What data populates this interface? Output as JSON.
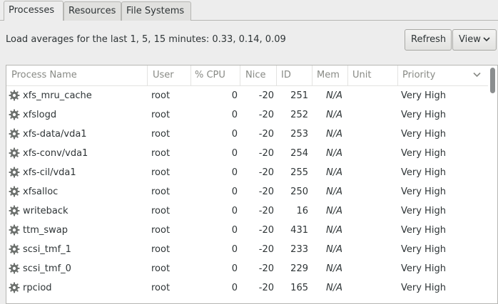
{
  "tabs": [
    {
      "label": "Processes",
      "active": true
    },
    {
      "label": "Resources",
      "active": false
    },
    {
      "label": "File Systems",
      "active": false
    }
  ],
  "load_text": "Load averages for the last 1, 5, 15 minutes: 0.33, 0.14, 0.09",
  "buttons": {
    "refresh": "Refresh",
    "view": "View"
  },
  "columns": {
    "name": "Process Name",
    "user": "User",
    "cpu": "% CPU",
    "nice": "Nice",
    "id": "ID",
    "mem": "Mem",
    "unit": "Unit",
    "priority": "Priority"
  },
  "sort_indicator": "chevron-down",
  "rows": [
    {
      "name": "xfs_mru_cache",
      "user": "root",
      "cpu": "0",
      "nice": "-20",
      "id": "251",
      "mem": "N/A",
      "unit": "",
      "priority": "Very High"
    },
    {
      "name": "xfslogd",
      "user": "root",
      "cpu": "0",
      "nice": "-20",
      "id": "252",
      "mem": "N/A",
      "unit": "",
      "priority": "Very High"
    },
    {
      "name": "xfs-data/vda1",
      "user": "root",
      "cpu": "0",
      "nice": "-20",
      "id": "253",
      "mem": "N/A",
      "unit": "",
      "priority": "Very High"
    },
    {
      "name": "xfs-conv/vda1",
      "user": "root",
      "cpu": "0",
      "nice": "-20",
      "id": "254",
      "mem": "N/A",
      "unit": "",
      "priority": "Very High"
    },
    {
      "name": "xfs-cil/vda1",
      "user": "root",
      "cpu": "0",
      "nice": "-20",
      "id": "255",
      "mem": "N/A",
      "unit": "",
      "priority": "Very High"
    },
    {
      "name": "xfsalloc",
      "user": "root",
      "cpu": "0",
      "nice": "-20",
      "id": "250",
      "mem": "N/A",
      "unit": "",
      "priority": "Very High"
    },
    {
      "name": "writeback",
      "user": "root",
      "cpu": "0",
      "nice": "-20",
      "id": "16",
      "mem": "N/A",
      "unit": "",
      "priority": "Very High"
    },
    {
      "name": "ttm_swap",
      "user": "root",
      "cpu": "0",
      "nice": "-20",
      "id": "431",
      "mem": "N/A",
      "unit": "",
      "priority": "Very High"
    },
    {
      "name": "scsi_tmf_1",
      "user": "root",
      "cpu": "0",
      "nice": "-20",
      "id": "233",
      "mem": "N/A",
      "unit": "",
      "priority": "Very High"
    },
    {
      "name": "scsi_tmf_0",
      "user": "root",
      "cpu": "0",
      "nice": "-20",
      "id": "229",
      "mem": "N/A",
      "unit": "",
      "priority": "Very High"
    },
    {
      "name": "rpciod",
      "user": "root",
      "cpu": "0",
      "nice": "-20",
      "id": "165",
      "mem": "N/A",
      "unit": "",
      "priority": "Very High"
    }
  ],
  "row_icon": "gear-icon",
  "colors": {
    "background": "#ededed",
    "list_background": "#ffffff",
    "header_text": "#888a85",
    "text": "#2e3436"
  }
}
